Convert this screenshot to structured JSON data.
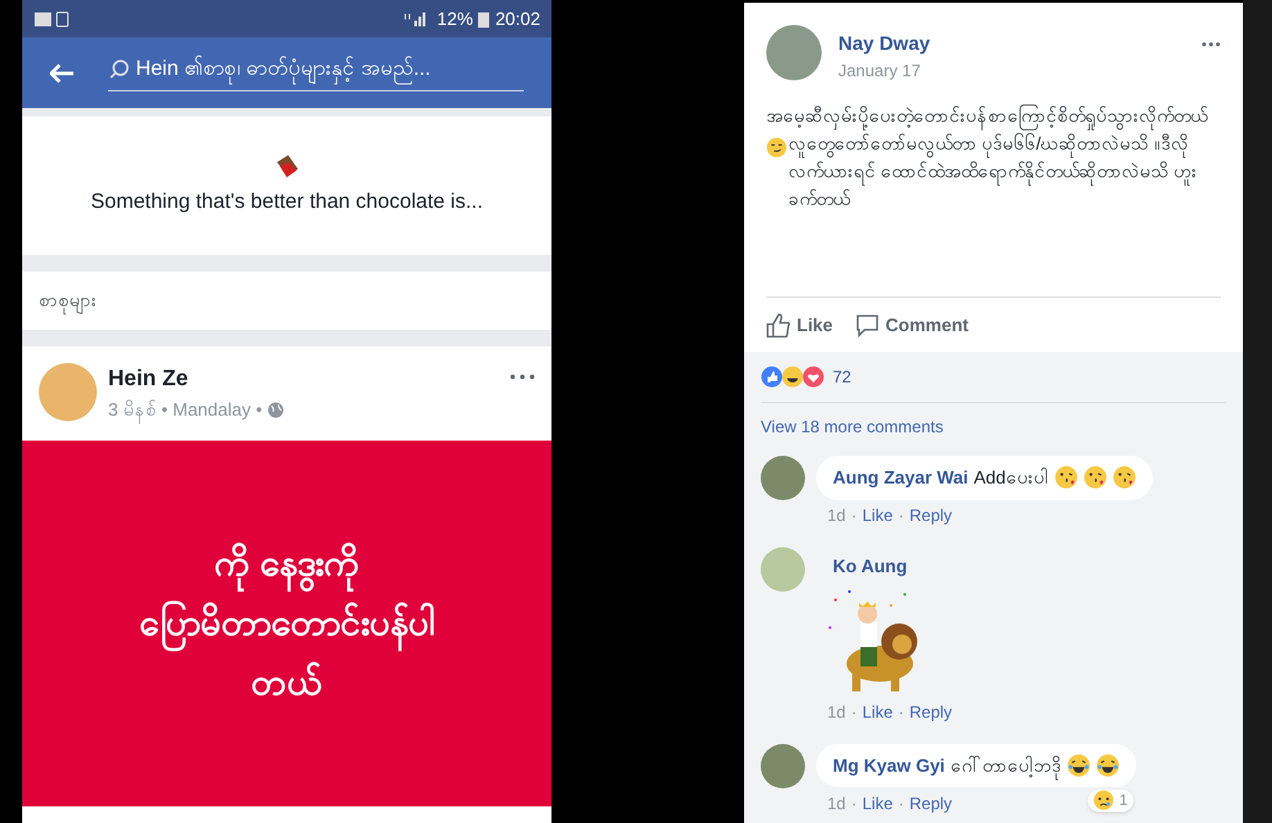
{
  "phone": {
    "status_bar": {
      "battery": "12%",
      "time": "20:02"
    },
    "search": {
      "value": "Hein ၏စာစု၊ ဓာတ်ပုံများနှင့် အမည်..."
    },
    "prompt": {
      "text": "Something that's better than chocolate is..."
    },
    "section_label": "စာစုများ",
    "post": {
      "author": "Hein Ze",
      "meta": "3 မိနစ် • Mandalay •",
      "image_lines": [
        "ကို နေဒွးကို",
        "ပြောမိတာတောင်းပန်ပါ",
        "တယ်"
      ]
    }
  },
  "post": {
    "author": "Nay Dway",
    "date": "January 17",
    "text_before_emoji": "အမေ့ဆီလှမ်းပို့ပေးတဲ့တောင်းပန်စာကြောင့်စိတ်ရှုပ်သွားလိုက်တယ်",
    "text_after_emoji": "လူတွေတော်တော်မလွယ်တာ ပုဒ်မ၆၆/ဃဆိုတာလဲမသိ ။ဒီလိုလက်ယားရင် ထောင်ထဲအထိရောက်နိုင်တယ်ဆိုတာလဲမသိ ဟူးခက်တယ်",
    "actions": [
      {
        "kind": "like",
        "label": "Like"
      },
      {
        "kind": "comment",
        "label": "Comment"
      }
    ],
    "reaction_count": "72",
    "view_more": "View 18 more comments",
    "comments": [
      {
        "kind": "text",
        "author": "Aung Zayar Wai",
        "text": "Addပေးပါ",
        "emojis": [
          {
            "kind": "kiss"
          },
          {
            "kind": "kiss"
          },
          {
            "kind": "kiss"
          }
        ],
        "time": "1d",
        "separator": "·",
        "like": "Like",
        "reply": "Reply"
      },
      {
        "kind": "sticker",
        "author": "Ko Aung",
        "time": "1d",
        "separator": "·",
        "like": "Like",
        "reply": "Reply"
      },
      {
        "kind": "text",
        "author": "Mg Kyaw Gyi",
        "text": "ဂေါ်တာပေါ့ဘဒို",
        "emojis": [
          {
            "kind": "laugh"
          },
          {
            "kind": "laugh"
          }
        ],
        "reaction": {
          "count": "1"
        },
        "time": "1d",
        "separator": "·",
        "like": "Like",
        "reply": "Reply"
      }
    ]
  }
}
